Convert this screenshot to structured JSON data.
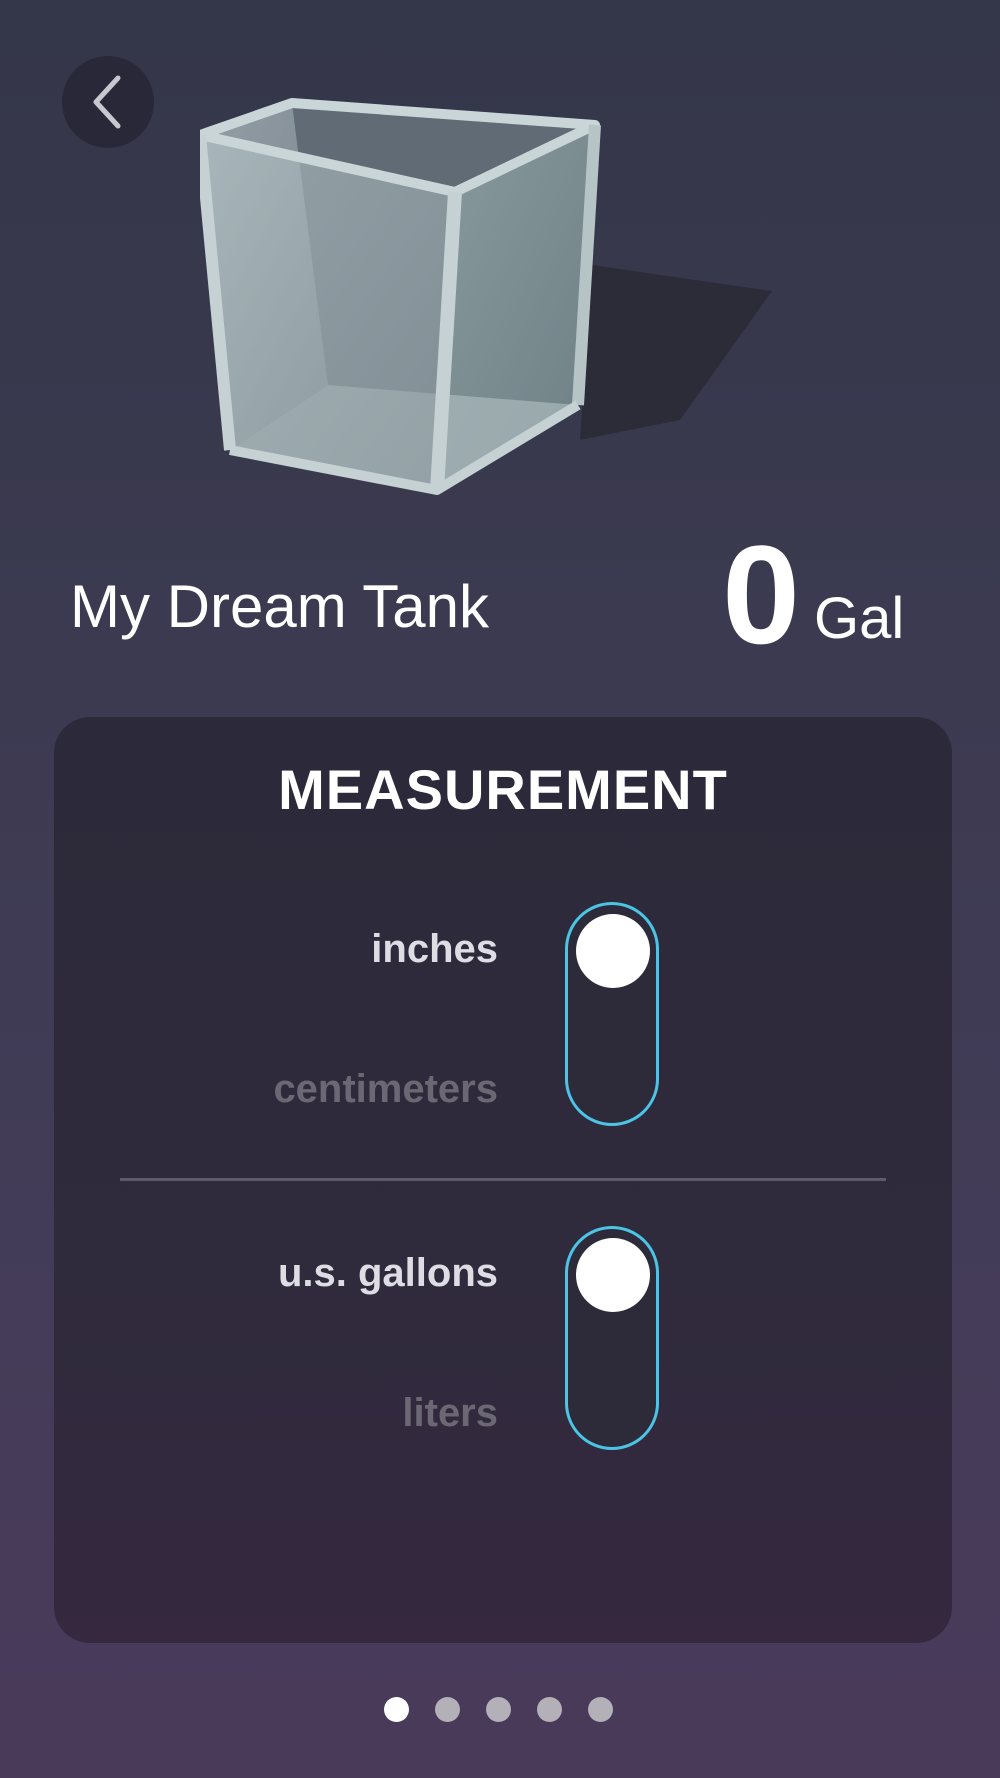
{
  "header": {
    "back_icon": "chevron-left-icon"
  },
  "tank": {
    "name": "My Dream Tank",
    "volume": "0",
    "volume_unit": "Gal"
  },
  "measurement": {
    "title": "MEASUREMENT",
    "length_toggle": {
      "selected": "inches",
      "option_on": "inches",
      "option_off": "centimeters"
    },
    "volume_toggle": {
      "selected": "u.s. gallons",
      "option_on": "u.s. gallons",
      "option_off": "liters"
    }
  },
  "pager": {
    "total": 5,
    "current": 1
  },
  "colors": {
    "toggle_outline": "#4cc4e6",
    "active_option": "#dddde3",
    "inactive_option": "#6c6873"
  }
}
